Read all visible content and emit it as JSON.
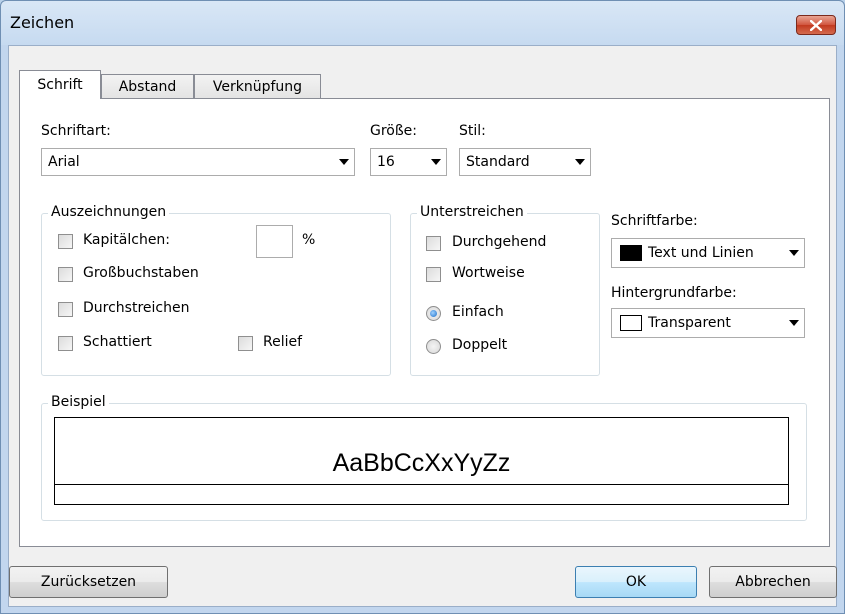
{
  "window": {
    "title": "Zeichen"
  },
  "tabs": [
    {
      "label": "Schrift"
    },
    {
      "label": "Abstand"
    },
    {
      "label": "Verknüpfung"
    }
  ],
  "font": {
    "family_label": "Schriftart:",
    "family_value": "Arial",
    "size_label": "Größe:",
    "size_value": "16",
    "style_label": "Stil:",
    "style_value": "Standard"
  },
  "markup": {
    "legend": "Auszeichnungen",
    "small_caps": "Kapitälchen:",
    "percent_value": "",
    "percent_unit": "%",
    "uppercase": "Großbuchstaben",
    "strikethrough": "Durchstreichen",
    "shadowed": "Schattiert",
    "relief": "Relief"
  },
  "underline": {
    "legend": "Unterstreichen",
    "continuous": "Durchgehend",
    "word_by_word": "Wortweise",
    "single": "Einfach",
    "double": "Doppelt",
    "selected": "single"
  },
  "colors": {
    "font_color_label": "Schriftfarbe:",
    "font_color_value": "Text und Linien",
    "font_color_swatch": "#000000",
    "background_label": "Hintergrundfarbe:",
    "background_value": "Transparent",
    "background_swatch": "#ffffff"
  },
  "sample": {
    "legend": "Beispiel",
    "text": "AaBbCcXxYyZz"
  },
  "buttons": {
    "reset": "Zurücksetzen",
    "ok": "OK",
    "cancel": "Abbrechen"
  }
}
